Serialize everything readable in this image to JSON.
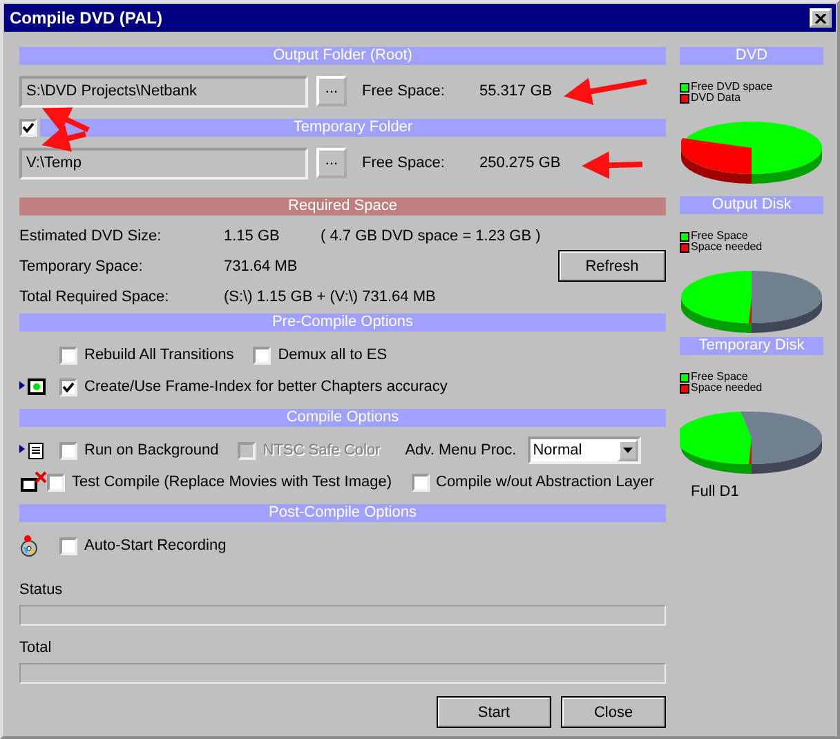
{
  "window": {
    "title": "Compile DVD (PAL)"
  },
  "output_folder": {
    "header": "Output Folder (Root)",
    "path": "S:\\DVD Projects\\Netbank",
    "browse": "...",
    "free_label": "Free Space:",
    "free_value": "55.317 GB"
  },
  "temporary_folder": {
    "checked": true,
    "header": "Temporary Folder",
    "path": "V:\\Temp",
    "browse": "...",
    "free_label": "Free Space:",
    "free_value": "250.275 GB"
  },
  "required_space": {
    "header": "Required Space",
    "refresh": "Refresh",
    "rows": [
      {
        "label": "Estimated DVD Size:",
        "value": "1.15 GB",
        "note": "( 4.7 GB DVD space = 1.23 GB )"
      },
      {
        "label": "Temporary Space:",
        "value": "731.64 MB"
      },
      {
        "label": "Total Required Space:",
        "value": "(S:\\) 1.15 GB + (V:\\) 731.64 MB"
      }
    ]
  },
  "pre_compile": {
    "header": "Pre-Compile Options",
    "rows": [
      {
        "items": [
          {
            "kind": "checkbox",
            "label": "Rebuild All Transitions",
            "checked": false,
            "disabled": false
          },
          {
            "kind": "checkbox",
            "label": "Demux all to ES",
            "checked": false,
            "disabled": false
          }
        ]
      },
      {
        "items": [
          {
            "kind": "checkbox",
            "label": "Create/Use Frame-Index for better Chapters accuracy",
            "checked": true,
            "disabled": false
          }
        ]
      }
    ]
  },
  "compile": {
    "header": "Compile Options",
    "rows": [
      {
        "items": [
          {
            "kind": "checkbox",
            "label": "Run on Background",
            "checked": false,
            "disabled": false
          },
          {
            "kind": "checkbox",
            "label": "NTSC Safe Color",
            "checked": false,
            "disabled": true
          },
          {
            "kind": "select",
            "label": "Adv. Menu Proc.",
            "value": "Normal"
          }
        ]
      },
      {
        "items": [
          {
            "kind": "checkbox",
            "label": "Test Compile (Replace Movies with Test Image)",
            "checked": false,
            "disabled": false
          },
          {
            "kind": "checkbox",
            "label": "Compile w/out Abstraction Layer",
            "checked": false,
            "disabled": false
          }
        ]
      }
    ]
  },
  "post_compile": {
    "header": "Post-Compile Options",
    "rows": [
      {
        "items": [
          {
            "kind": "checkbox",
            "label": "Auto-Start Recording",
            "checked": false,
            "disabled": false
          }
        ]
      }
    ]
  },
  "progress": [
    {
      "label": "Status",
      "level": 0
    },
    {
      "label": "Total",
      "level": 0
    }
  ],
  "buttons": [
    "Start",
    "Close"
  ],
  "charts": [
    {
      "title": "DVD",
      "legend": [
        {
          "label": "Free DVD space",
          "color": "#00ff00"
        },
        {
          "label": "DVD Data",
          "color": "#ff0000"
        }
      ]
    },
    {
      "title": "Output Disk",
      "legend": [
        {
          "label": "Free Space",
          "color": "#00ff00"
        },
        {
          "label": "Space needed",
          "color": "#ff0000"
        }
      ]
    },
    {
      "title": "Temporary Disk",
      "legend": [
        {
          "label": "Free Space",
          "color": "#00ff00"
        },
        {
          "label": "Space needed",
          "color": "#ff0000"
        }
      ]
    }
  ],
  "mode": "Full D1"
}
